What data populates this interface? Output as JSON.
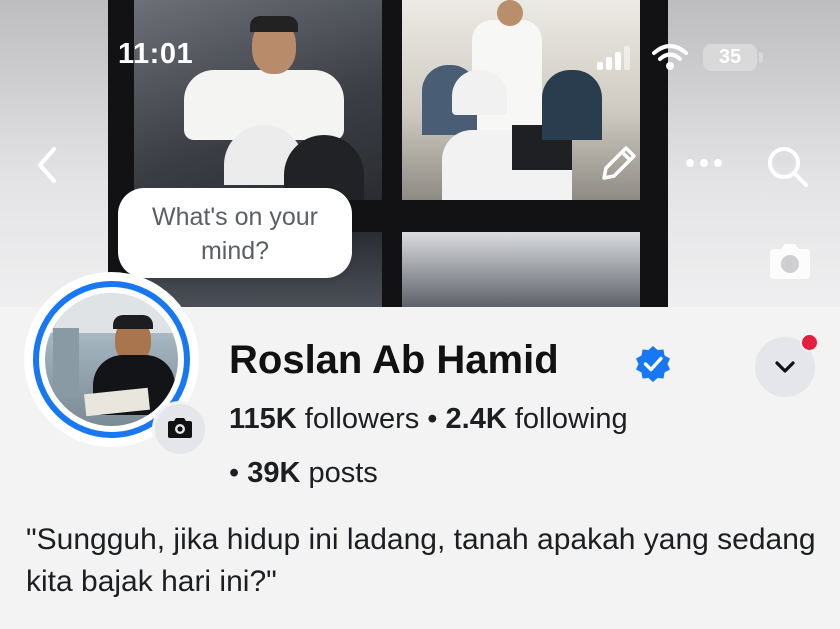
{
  "status_bar": {
    "time": "11:01",
    "battery": "35"
  },
  "composer": {
    "prompt_line1": "What's on your",
    "prompt_line2": "mind?"
  },
  "profile": {
    "name": "Roslan Ab Hamid",
    "followers_count": "115K",
    "followers_label": "followers",
    "separator": "•",
    "following_count": "2.4K",
    "following_label": "following",
    "posts_count": "39K",
    "posts_label": "posts",
    "bio": "\"Sungguh, jika hidup ini ladang, tanah apakah yang sedang kita bajak hari ini?\""
  },
  "icons": {
    "back": "chevron-left-icon",
    "edit": "pencil-icon",
    "more": "more-horizontal-icon",
    "search": "search-icon",
    "cover_camera": "camera-icon",
    "avatar_camera": "camera-icon",
    "verified": "verified-badge-icon",
    "dropdown": "chevron-down-icon"
  },
  "colors": {
    "accent": "#1877f2",
    "notification": "#e41e3f"
  }
}
